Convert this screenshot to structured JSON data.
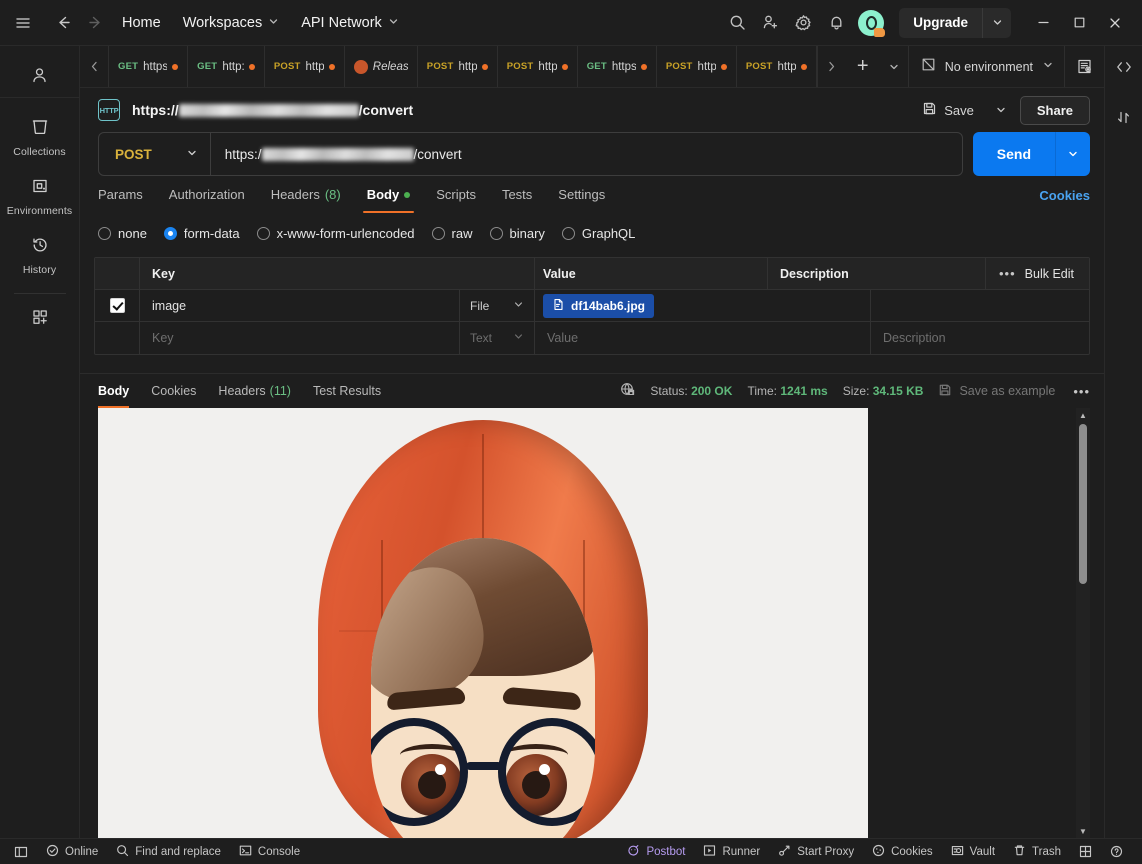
{
  "topbar": {
    "home": "Home",
    "workspaces": "Workspaces",
    "api_network": "API Network",
    "upgrade": "Upgrade",
    "icons": [
      "hamburger-icon",
      "back-arrow-icon",
      "forward-arrow-icon",
      "search-icon",
      "invite-user-icon",
      "settings-gear-icon",
      "notifications-bell-icon",
      "account-avatar"
    ]
  },
  "rail": {
    "items": [
      {
        "label": "Collections",
        "icon": "collections-icon"
      },
      {
        "label": "Environments",
        "icon": "environments-icon"
      },
      {
        "label": "History",
        "icon": "history-icon"
      }
    ],
    "add_label": "",
    "user_icon": "user-icon"
  },
  "tabstrip": {
    "tabs": [
      {
        "method": "GET",
        "title": "https",
        "dirty": true
      },
      {
        "method": "GET",
        "title": "http:",
        "dirty": true
      },
      {
        "method": "POST",
        "title": "http",
        "dirty": true
      },
      {
        "method": "",
        "title": "Releas",
        "dirty": false,
        "kind": "release"
      },
      {
        "method": "POST",
        "title": "http",
        "dirty": true
      },
      {
        "method": "POST",
        "title": "http",
        "dirty": true
      },
      {
        "method": "GET",
        "title": "https",
        "dirty": true
      },
      {
        "method": "POST",
        "title": "http",
        "dirty": true
      },
      {
        "method": "POST",
        "title": "http",
        "dirty": true
      }
    ],
    "environment": "No environment"
  },
  "request": {
    "title_prefix": "https://",
    "title_suffix": "/convert",
    "method": "POST",
    "url_prefix": "https:/",
    "url_suffix": "/convert",
    "save_label": "Save",
    "share_label": "Share",
    "send_label": "Send",
    "cookies_label": "Cookies",
    "tabs": [
      {
        "label": "Params"
      },
      {
        "label": "Authorization"
      },
      {
        "label": "Headers",
        "count": "(8)"
      },
      {
        "label": "Body",
        "active": true,
        "dot": true
      },
      {
        "label": "Scripts"
      },
      {
        "label": "Tests"
      },
      {
        "label": "Settings"
      }
    ]
  },
  "body": {
    "types": [
      {
        "label": "none",
        "selected": false
      },
      {
        "label": "form-data",
        "selected": true
      },
      {
        "label": "x-www-form-urlencoded",
        "selected": false
      },
      {
        "label": "raw",
        "selected": false
      },
      {
        "label": "binary",
        "selected": false
      },
      {
        "label": "GraphQL",
        "selected": false
      }
    ],
    "columns": {
      "key": "Key",
      "value": "Value",
      "description": "Description"
    },
    "bulk_edit": "Bulk Edit",
    "rows": [
      {
        "checked": true,
        "key": "image",
        "type": "File",
        "value": "df14bab6.jpg",
        "description": ""
      }
    ],
    "placeholder_row": {
      "key": "Key",
      "type": "Text",
      "value": "Value",
      "description": "Description"
    }
  },
  "response": {
    "tabs": [
      {
        "label": "Body",
        "active": true
      },
      {
        "label": "Cookies"
      },
      {
        "label": "Headers",
        "count": "(11)"
      },
      {
        "label": "Test Results"
      }
    ],
    "status_key": "Status:",
    "status_value": "200 OK",
    "time_key": "Time:",
    "time_value": "1241 ms",
    "size_key": "Size:",
    "size_value": "34.15 KB",
    "save_as_example": "Save as example",
    "more": "•••",
    "image_alt": "cartoon boy wearing orange hoodie and round black glasses"
  },
  "footer": {
    "left": [
      {
        "label": "",
        "icon": "sidebar-toggle-icon"
      },
      {
        "label": "Online",
        "icon": "online-status-icon"
      },
      {
        "label": "Find and replace",
        "icon": "search-icon"
      },
      {
        "label": "Console",
        "icon": "console-icon"
      }
    ],
    "right": [
      {
        "label": "Postbot",
        "icon": "postbot-icon"
      },
      {
        "label": "Runner",
        "icon": "runner-icon"
      },
      {
        "label": "Start Proxy",
        "icon": "proxy-icon"
      },
      {
        "label": "Cookies",
        "icon": "cookie-icon"
      },
      {
        "label": "Vault",
        "icon": "vault-icon"
      },
      {
        "label": "Trash",
        "icon": "trash-icon"
      },
      {
        "label": "",
        "icon": "layout-grid-icon"
      },
      {
        "label": "",
        "icon": "help-icon"
      }
    ]
  },
  "colors": {
    "accent_blue": "#0b79f0",
    "method_post": "#d9b23c",
    "method_get": "#6bbf84",
    "status_green": "#5fb87a",
    "tab_underline": "#f07128",
    "link_blue": "#4aa3f0",
    "file_chip": "#1b4ea8"
  }
}
